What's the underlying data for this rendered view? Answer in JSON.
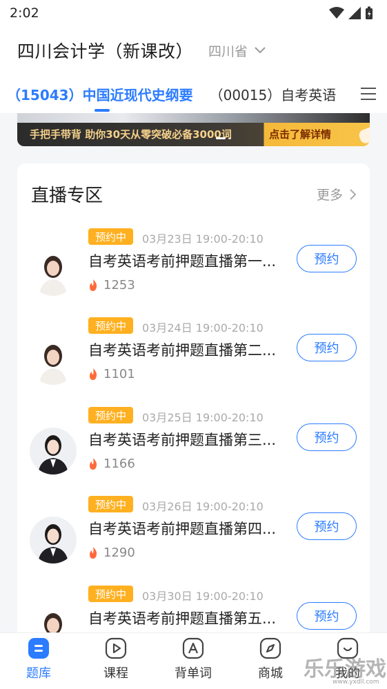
{
  "status_bar": {
    "time": "2:02"
  },
  "header": {
    "title": "四川会计学（新课改）",
    "province": "四川省"
  },
  "tabs": [
    {
      "label": "（15043）中国近现代史纲要"
    },
    {
      "label": "（00015）自考英语"
    }
  ],
  "banner": {
    "left_text": "手把手带背 助你30天从零突破必备3000词",
    "right_text": "点击了解详情"
  },
  "live_section": {
    "title": "直播专区",
    "more_label": "更多",
    "items": [
      {
        "status": "预约中",
        "time": "03月23日 19:00-20:10",
        "title": "自考英语考前押题直播第一...",
        "heat": "1253",
        "button": "预约"
      },
      {
        "status": "预约中",
        "time": "03月24日 19:00-20:10",
        "title": "自考英语考前押题直播第二...",
        "heat": "1101",
        "button": "预约"
      },
      {
        "status": "预约中",
        "time": "03月25日 19:00-20:10",
        "title": "自考英语考前押题直播第三...",
        "heat": "1166",
        "button": "预约"
      },
      {
        "status": "预约中",
        "time": "03月26日 19:00-20:10",
        "title": "自考英语考前押题直播第四...",
        "heat": "1290",
        "button": "预约"
      },
      {
        "status": "预约中",
        "time": "03月30日 19:00-20:10",
        "title": "自考英语考前押题直播第五...",
        "heat": "",
        "button": "预约"
      }
    ]
  },
  "bottom_nav": [
    {
      "label": "题库",
      "icon": "question-bank-icon",
      "active": true
    },
    {
      "label": "课程",
      "icon": "play-icon"
    },
    {
      "label": "背单词",
      "icon": "letter-a-icon"
    },
    {
      "label": "商城",
      "icon": "compass-icon"
    },
    {
      "label": "我的",
      "icon": "smile-icon"
    }
  ],
  "watermark": {
    "text": "乐乐游戏",
    "url": "www.yxdll.com"
  },
  "colors": {
    "accent": "#2b7cff",
    "badge": "#ffb020",
    "heat": "#ff6a3c"
  }
}
